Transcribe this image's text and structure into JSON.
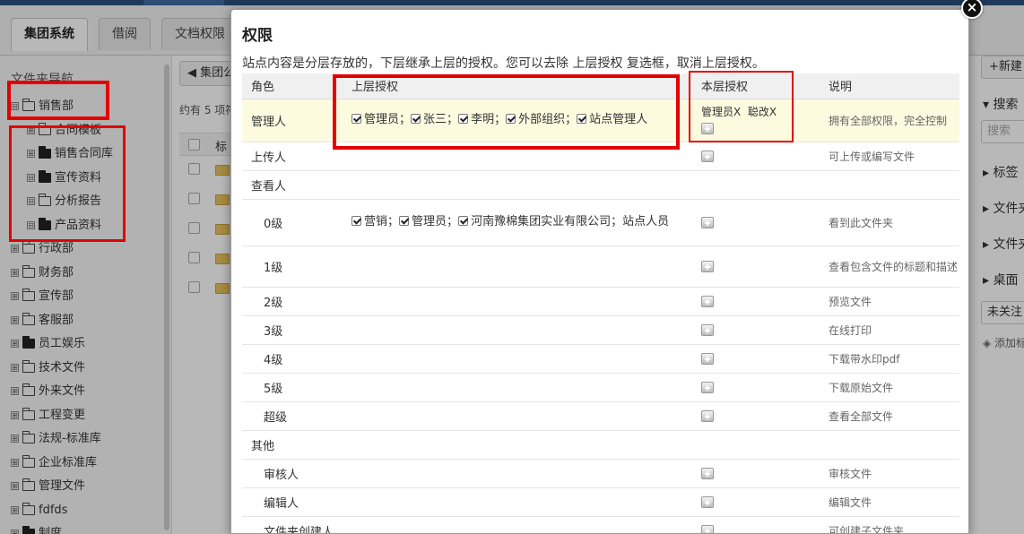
{
  "tabs": [
    "集团系统",
    "借阅",
    "文档权限"
  ],
  "sidebar": {
    "title": "文件夹导航",
    "tree": [
      {
        "label": "销售部",
        "exp": "⊟",
        "filled": false,
        "level": 0
      },
      {
        "label": "合同模板",
        "exp": "⊞",
        "filled": false,
        "level": 1
      },
      {
        "label": "销售合同库",
        "exp": "⊞",
        "filled": true,
        "level": 1
      },
      {
        "label": "宣传资料",
        "exp": "⊟",
        "filled": true,
        "level": 1
      },
      {
        "label": "分析报告",
        "exp": "⊟",
        "filled": false,
        "level": 1
      },
      {
        "label": "产品资料",
        "exp": "⊟",
        "filled": true,
        "level": 1
      },
      {
        "label": "行政部",
        "exp": "⊞",
        "filled": false,
        "level": 0
      },
      {
        "label": "财务部",
        "exp": "⊞",
        "filled": false,
        "level": 0
      },
      {
        "label": "宣传部",
        "exp": "⊞",
        "filled": false,
        "level": 0
      },
      {
        "label": "客服部",
        "exp": "⊞",
        "filled": false,
        "level": 0
      },
      {
        "label": "员工娱乐",
        "exp": "⊞",
        "filled": true,
        "level": 0
      },
      {
        "label": "技术文件",
        "exp": "⊞",
        "filled": false,
        "level": 0
      },
      {
        "label": "外来文件",
        "exp": "⊞",
        "filled": false,
        "level": 0
      },
      {
        "label": "工程变更",
        "exp": "⊞",
        "filled": false,
        "level": 0
      },
      {
        "label": "法规-标准库",
        "exp": "⊞",
        "filled": false,
        "level": 0
      },
      {
        "label": "企业标准库",
        "exp": "⊞",
        "filled": false,
        "level": 0
      },
      {
        "label": "管理文件",
        "exp": "⊞",
        "filled": false,
        "level": 0
      },
      {
        "label": "fdfds",
        "exp": "⊞",
        "filled": false,
        "level": 0
      },
      {
        "label": "制度",
        "exp": "⊞",
        "filled": true,
        "level": 0
      }
    ]
  },
  "main": {
    "back_label": "集团公",
    "count_text": "约有 5 项符",
    "col_label": "标"
  },
  "right_panel": {
    "new_label": "+新建",
    "search_label": "搜索",
    "search_placeholder": "搜索",
    "items": [
      "标签",
      "文件夹",
      "文件夹",
      "桌面"
    ],
    "unfollow_label": "未关注",
    "add_tag_label": "添加标"
  },
  "modal": {
    "title": "权限",
    "description": "站点内容是分层存放的，下层继承上层的授权。您可以去除 上层授权 复选框，取消上层授权。",
    "close_label": "×",
    "headers": {
      "role": "角色",
      "inherited": "上层授权",
      "own": "本层授权",
      "desc": "说明"
    },
    "rows": [
      {
        "role": "管理人",
        "inherited": [
          "管理员",
          "张三",
          "李明",
          "外部组织",
          "站点管理人"
        ],
        "own": [
          "管理员X",
          "聪改X"
        ],
        "desc": "拥有全部权限，完全控制",
        "type": "role"
      },
      {
        "role": "上传人",
        "inherited": [],
        "desc": "可上传或编写文件",
        "type": "role"
      },
      {
        "role": "查看人",
        "type": "group"
      },
      {
        "role": "0级",
        "inherited_text": [
          "营销",
          "管理员",
          "河南豫棉集团实业有限公司",
          "站点人员"
        ],
        "desc": "看到此文件夹",
        "type": "sub"
      },
      {
        "role": "1级",
        "desc": "查看包含文件的标题和描述",
        "type": "sub"
      },
      {
        "role": "2级",
        "desc": "预览文件",
        "type": "sub"
      },
      {
        "role": "3级",
        "desc": "在线打印",
        "type": "sub"
      },
      {
        "role": "4级",
        "desc": "下载带水印pdf",
        "type": "sub"
      },
      {
        "role": "5级",
        "desc": "下载原始文件",
        "type": "sub"
      },
      {
        "role": "超级",
        "desc": "查看全部文件",
        "type": "sub"
      },
      {
        "role": "其他",
        "type": "group"
      },
      {
        "role": "审核人",
        "desc": "审核文件",
        "type": "sub"
      },
      {
        "role": "编辑人",
        "desc": "编辑文件",
        "type": "sub"
      },
      {
        "role": "文件夹创建人",
        "desc": "可创建子文件夹",
        "type": "sub"
      }
    ]
  }
}
